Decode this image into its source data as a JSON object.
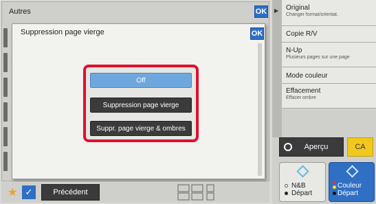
{
  "back_panel": {
    "title": "Autres",
    "ok_label": "OK"
  },
  "modal": {
    "title": "Suppression page vierge",
    "ok_label": "OK",
    "options": [
      {
        "label": "Off",
        "selected": true
      },
      {
        "label": "Suppression page vierge",
        "selected": false
      },
      {
        "label": "Suppr. page vierge & ombres",
        "selected": false
      }
    ]
  },
  "bottom_bar": {
    "previous_label": "Précédent"
  },
  "right_panel": {
    "items": [
      {
        "label": "Original",
        "sub": "Changer format/orientat."
      },
      {
        "label": "Copie R/V",
        "sub": ""
      },
      {
        "label": "N-Up",
        "sub": "Plusieurs pages sur une page"
      },
      {
        "label": "Mode couleur",
        "sub": ""
      },
      {
        "label": "Effacement",
        "sub": "Effacer ombre"
      }
    ],
    "preview_label": "Aperçu",
    "ca_label": "CA",
    "bw_start": {
      "line1": "N&B",
      "line2": "Départ"
    },
    "color_start": {
      "line1": "Couleur",
      "line2": "Départ"
    }
  },
  "colors": {
    "accent": "#2f6fc4",
    "highlight": "#e0102d",
    "selected": "#6ea7dd",
    "ca": "#f1c81e"
  }
}
